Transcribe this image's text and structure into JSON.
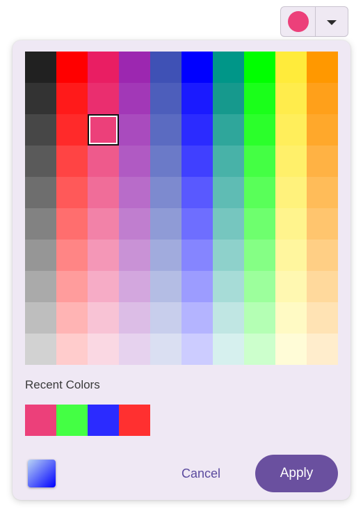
{
  "color_picker": {
    "current_color": "#ec407a",
    "palette": [
      [
        "#212121",
        "#ff0000",
        "#e91e63",
        "#9c27b0",
        "#3f51b5",
        "#0000ff",
        "#009688",
        "#00ff00",
        "#ffeb3b",
        "#ff9800"
      ],
      [
        "#333333",
        "#ff1a1a",
        "#ea2e6f",
        "#a238b7",
        "#4d5ebb",
        "#1a1aff",
        "#16998d",
        "#1aff1a",
        "#ffec4c",
        "#ffa01a"
      ],
      [
        "#474747",
        "#ff2a2a",
        "#ec407a",
        "#a94bbe",
        "#5b6bc1",
        "#2b2bff",
        "#2fa69b",
        "#2bff2b",
        "#ffee5b",
        "#ffa82b"
      ],
      [
        "#5a5a5a",
        "#ff4444",
        "#ee5a8c",
        "#b05ac3",
        "#6b7ac8",
        "#4040ff",
        "#48b2a8",
        "#44ff44",
        "#fff06a",
        "#ffb244"
      ],
      [
        "#6e6e6e",
        "#ff5959",
        "#f06d99",
        "#b86cc9",
        "#7d8acf",
        "#5959ff",
        "#5fbcb4",
        "#59ff59",
        "#fff27c",
        "#ffbc59"
      ],
      [
        "#828282",
        "#ff6e6e",
        "#f282a8",
        "#c07ecf",
        "#8f9bd6",
        "#6e6eff",
        "#76c6bf",
        "#6eff6e",
        "#fff48d",
        "#ffc56e"
      ],
      [
        "#969696",
        "#ff8585",
        "#f497b7",
        "#c992d6",
        "#a1abdd",
        "#8585ff",
        "#8ed1cb",
        "#85ff85",
        "#fff69e",
        "#ffcf85"
      ],
      [
        "#aaaaaa",
        "#ff9c9c",
        "#f6acc6",
        "#d3a7de",
        "#b4bde4",
        "#9c9cff",
        "#a7dcd7",
        "#9cff9c",
        "#fff8b1",
        "#ffd99c"
      ],
      [
        "#bebebe",
        "#ffb4b4",
        "#f8c3d5",
        "#dcbde6",
        "#c8ceec",
        "#b4b4ff",
        "#c0e6e3",
        "#b4ffb4",
        "#fffac4",
        "#ffe3b4"
      ],
      [
        "#d2d2d2",
        "#ffcccc",
        "#fad8e3",
        "#e6d2ee",
        "#dadff2",
        "#ccccff",
        "#d6f0ee",
        "#ccffcc",
        "#fffcd7",
        "#ffedcc"
      ]
    ],
    "selected_cell": {
      "row": 2,
      "col": 2
    },
    "recent_label": "Recent Colors",
    "recent_colors": [
      "#ec407a",
      "#44ff44",
      "#2b2bff",
      "#ff3030"
    ],
    "mode_toggle_gradient": [
      "#b9d4f5",
      "#0000ff"
    ],
    "cancel_label": "Cancel",
    "apply_label": "Apply",
    "accent_color": "#6a509f"
  }
}
